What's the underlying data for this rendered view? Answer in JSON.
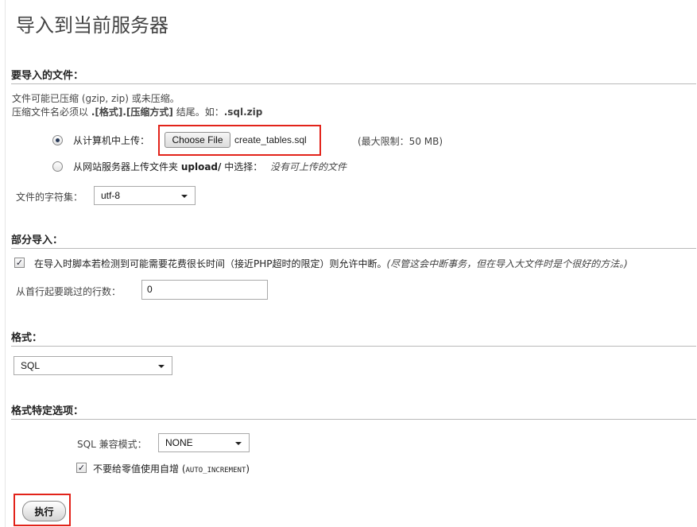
{
  "page": {
    "title": "导入到当前服务器"
  },
  "file_section": {
    "heading": "要导入的文件：",
    "compress_note": "文件可能已压缩 (gzip, zip) 或未压缩。",
    "name_rule": {
      "prefix": "压缩文件名必须以 ",
      "pattern": ".[格式].[压缩方式]",
      "middle": " 结尾。如：",
      "example": ".sql.zip"
    },
    "upload_local": {
      "label": "从计算机中上传：",
      "button": "Choose File",
      "file_name": "create_tables.sql",
      "limit": "(最大限制：50 MB)",
      "selected": true
    },
    "upload_server": {
      "label_prefix": "从网站服务器上传文件夹 ",
      "folder": "upload/",
      "label_suffix": " 中选择：",
      "none_note": "没有可上传的文件",
      "selected": false
    },
    "charset": {
      "label": "文件的字符集：",
      "value": "utf-8"
    }
  },
  "partial_section": {
    "heading": "部分导入：",
    "allow_interrupt": {
      "checked": true,
      "label": "在导入时脚本若检测到可能需要花费很长时间（接近PHP超时的限定）则允许中断。",
      "note": "(尽管这会中断事务，但在导入大文件时是个很好的方法。)"
    },
    "skip_rows": {
      "label": "从首行起要跳过的行数：",
      "value": "0"
    }
  },
  "format_section": {
    "heading": "格式：",
    "value": "SQL"
  },
  "format_options_section": {
    "heading": "格式特定选项：",
    "compat_mode": {
      "label": "SQL 兼容模式：",
      "value": "NONE"
    },
    "no_auto_zero": {
      "checked": true,
      "label": "不要给零值使用自增 (",
      "code": "AUTO_INCREMENT",
      "label_end": ")"
    }
  },
  "actions": {
    "go_label": "执行"
  },
  "colors": {
    "highlight": "#e2231a",
    "rule": "#b9b9b9"
  }
}
